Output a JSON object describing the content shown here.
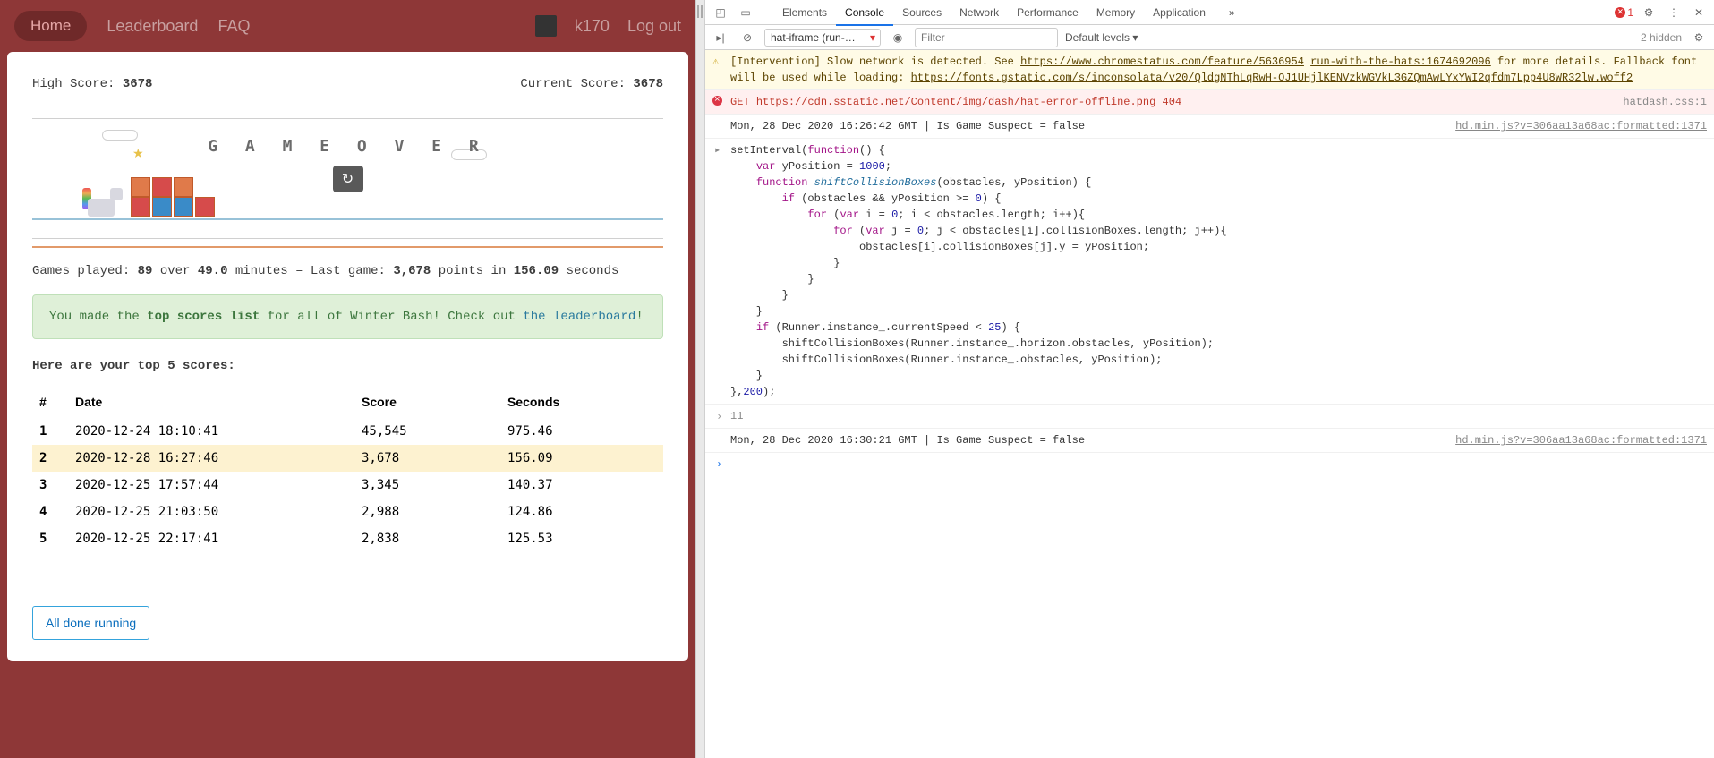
{
  "nav": {
    "home": "Home",
    "leaderboard": "Leaderboard",
    "faq": "FAQ",
    "username": "k170",
    "logout": "Log out"
  },
  "scores": {
    "high_label": "High Score: ",
    "high_value": "3678",
    "current_label": "Current Score: ",
    "current_value": "3678"
  },
  "game": {
    "gameover_text": "G A M E  O V E R",
    "replay_glyph": "↻"
  },
  "stats": {
    "prefix": "Games played: ",
    "games": "89",
    "over": " over ",
    "minutes": "49.0",
    "minutes_suffix": " minutes – Last game: ",
    "last_points": "3,678",
    "points_in": " points in ",
    "last_seconds": "156.09",
    "seconds_suffix": " seconds"
  },
  "alert": {
    "part1": "You made the ",
    "bold": "top scores list",
    "part2": " for all of Winter Bash! Check out ",
    "link_text": "the leaderboard",
    "part3": "!"
  },
  "top_title": "Here are your top 5 scores:",
  "table": {
    "headers": {
      "n": "#",
      "date": "Date",
      "score": "Score",
      "seconds": "Seconds"
    },
    "rows": [
      {
        "n": "1",
        "date": "2020-12-24 18:10:41",
        "score": "45,545",
        "seconds": "975.46",
        "hl": false
      },
      {
        "n": "2",
        "date": "2020-12-28 16:27:46",
        "score": "3,678",
        "seconds": "156.09",
        "hl": true
      },
      {
        "n": "3",
        "date": "2020-12-25 17:57:44",
        "score": "3,345",
        "seconds": "140.37",
        "hl": false
      },
      {
        "n": "4",
        "date": "2020-12-25 21:03:50",
        "score": "2,988",
        "seconds": "124.86",
        "hl": false
      },
      {
        "n": "5",
        "date": "2020-12-25 22:17:41",
        "score": "2,838",
        "seconds": "125.53",
        "hl": false
      }
    ]
  },
  "done_button": "All done running",
  "devtools": {
    "tabs": [
      "Elements",
      "Console",
      "Sources",
      "Network",
      "Performance",
      "Memory",
      "Application"
    ],
    "active_tab": "Console",
    "more_glyph": "»",
    "error_count": "1",
    "toolbar": {
      "context": "hat-iframe (run-wit…",
      "filter_placeholder": "Filter",
      "levels": "Default levels ▾",
      "hidden": "2 hidden"
    },
    "messages": [
      {
        "type": "warn",
        "text_pre": "[Intervention] Slow network is detected. See ",
        "link1": "https://www.chromestatus.com/feature/5636954",
        "text_mid": " ",
        "link2": "run-with-the-hats:1674692096",
        "text_mid2": " for more details. Fallback font will be used while loading: ",
        "link3": "https://fonts.gstatic.com/s/inconsolata/v20/QldgNThLqRwH-OJ1UHjlKENVzkWGVkL3GZQmAwLYxYWI2qfdm7Lpp4U8WR32lw.woff2"
      },
      {
        "type": "err",
        "pre": "GET ",
        "link": "https://cdn.sstatic.net/Content/img/dash/hat-error-offline.png",
        "post": " 404",
        "src": "hatdash.css:1"
      },
      {
        "type": "info",
        "text": "Mon, 28 Dec 2020 16:26:42 GMT | Is Game Suspect = false",
        "src": "hd.min.js?v=306aa13a68ac:formatted:1371"
      },
      {
        "type": "code",
        "src": ""
      },
      {
        "type": "result",
        "text": "11"
      },
      {
        "type": "info",
        "text": "Mon, 28 Dec 2020 16:30:21 GMT | Is Game Suspect = false",
        "src": "hd.min.js?v=306aa13a68ac:formatted:1371"
      }
    ],
    "code_lines": [
      [
        [
          "",
          "setInterval("
        ],
        [
          "kw",
          "function"
        ],
        [
          "",
          "() {"
        ]
      ],
      [
        [
          "",
          "    "
        ],
        [
          "kw",
          "var"
        ],
        [
          "",
          " yPosition = "
        ],
        [
          "num",
          "1000"
        ],
        [
          "",
          ";"
        ]
      ],
      [
        [
          "",
          "    "
        ],
        [
          "kw",
          "function"
        ],
        [
          "",
          " "
        ],
        [
          "fn",
          "shiftCollisionBoxes"
        ],
        [
          "",
          "(obstacles, yPosition) {"
        ]
      ],
      [
        [
          "",
          "        "
        ],
        [
          "kw",
          "if"
        ],
        [
          "",
          " (obstacles && yPosition >= "
        ],
        [
          "num",
          "0"
        ],
        [
          "",
          ") {"
        ]
      ],
      [
        [
          "",
          "            "
        ],
        [
          "kw",
          "for"
        ],
        [
          "",
          " ("
        ],
        [
          "kw",
          "var"
        ],
        [
          "",
          " i = "
        ],
        [
          "num",
          "0"
        ],
        [
          "",
          "; i < obstacles.length; i++){"
        ]
      ],
      [
        [
          "",
          "                "
        ],
        [
          "kw",
          "for"
        ],
        [
          "",
          " ("
        ],
        [
          "kw",
          "var"
        ],
        [
          "",
          " j = "
        ],
        [
          "num",
          "0"
        ],
        [
          "",
          "; j < obstacles[i].collisionBoxes.length; j++){"
        ]
      ],
      [
        [
          "",
          "                    obstacles[i].collisionBoxes[j].y = yPosition;"
        ]
      ],
      [
        [
          "",
          "                }"
        ]
      ],
      [
        [
          "",
          "            }"
        ]
      ],
      [
        [
          "",
          "        }"
        ]
      ],
      [
        [
          "",
          "    }"
        ]
      ],
      [
        [
          "",
          "    "
        ],
        [
          "kw",
          "if"
        ],
        [
          "",
          " (Runner.instance_.currentSpeed < "
        ],
        [
          "num",
          "25"
        ],
        [
          "",
          ") {"
        ]
      ],
      [
        [
          "",
          "        shiftCollisionBoxes(Runner.instance_.horizon.obstacles, yPosition);"
        ]
      ],
      [
        [
          "",
          "        shiftCollisionBoxes(Runner.instance_.obstacles, yPosition);"
        ]
      ],
      [
        [
          "",
          "    }"
        ]
      ],
      [
        [
          "",
          "},"
        ],
        [
          "num",
          "200"
        ],
        [
          "",
          ");"
        ]
      ]
    ]
  }
}
